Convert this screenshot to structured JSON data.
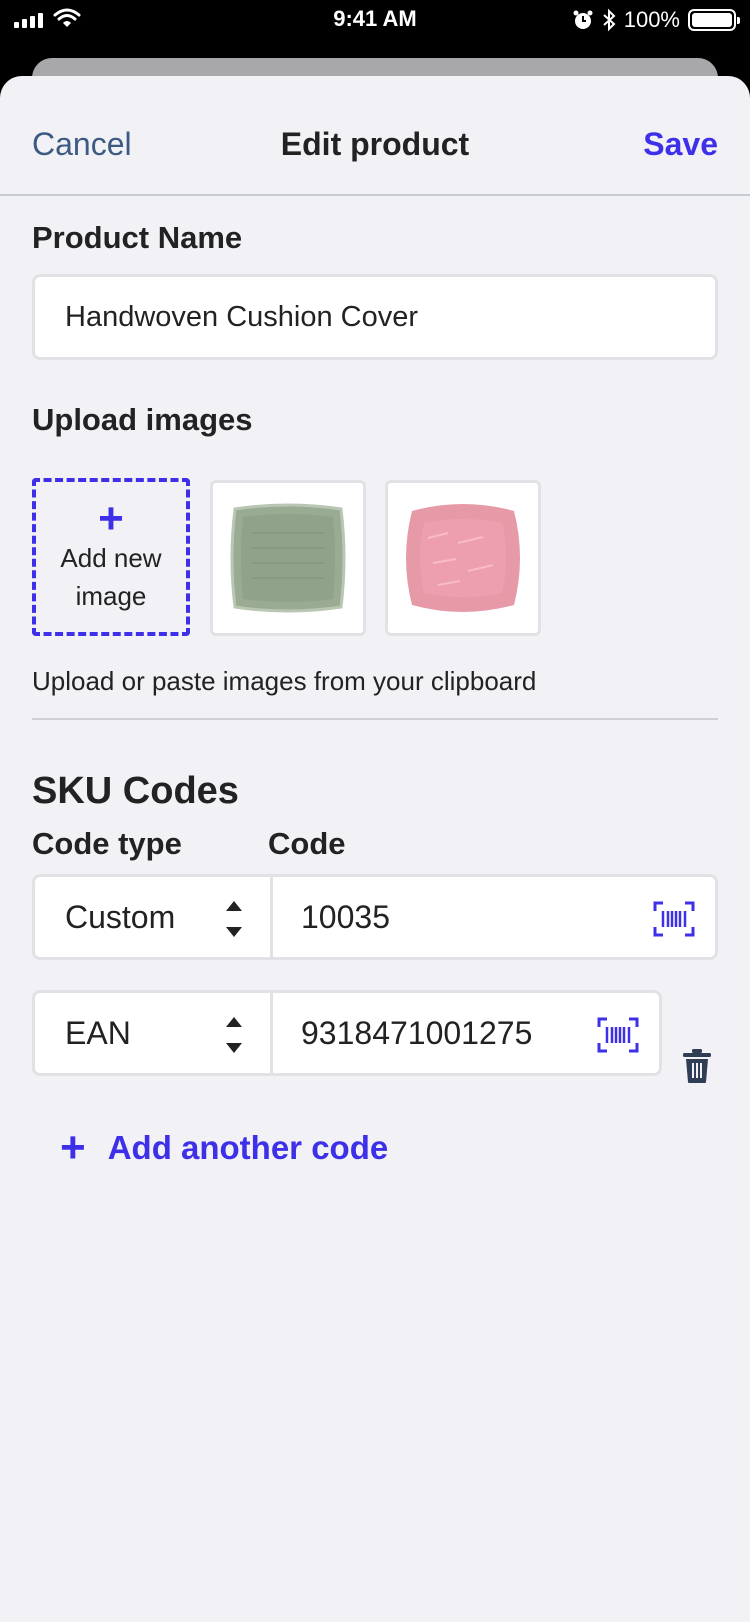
{
  "status_bar": {
    "time": "9:41 AM",
    "battery": "100%"
  },
  "nav": {
    "cancel": "Cancel",
    "title": "Edit product",
    "save": "Save"
  },
  "product_name": {
    "label": "Product Name",
    "value": "Handwoven Cushion Cover"
  },
  "images": {
    "label": "Upload images",
    "add_line1": "Add new",
    "add_line2": "image",
    "help": "Upload or paste images from your clipboard",
    "items": [
      {
        "name": "green-cushion-image",
        "color": "#9aab94"
      },
      {
        "name": "pink-cushion-image",
        "color": "#e69aa8"
      }
    ]
  },
  "sku": {
    "title": "SKU Codes",
    "col_type": "Code type",
    "col_code": "Code",
    "rows": [
      {
        "type": "Custom",
        "code": "10035"
      },
      {
        "type": "EAN",
        "code": "9318471001275"
      }
    ],
    "add_label": "Add another code"
  },
  "colors": {
    "accent": "#3d30e8",
    "link": "#3c5a84",
    "background": "#f2f1f5"
  }
}
